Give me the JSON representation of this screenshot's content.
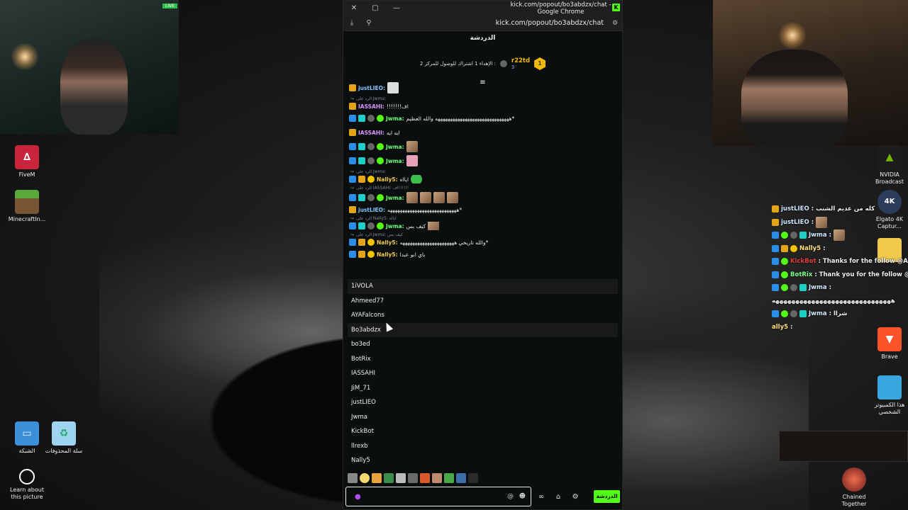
{
  "window": {
    "title": "kick.com/popout/bo3abdzx/chat - Google Chrome",
    "url": "kick.com/popout/bo3abdzx/chat",
    "brand_color": "#53fc18"
  },
  "chat": {
    "header": "الدردشة",
    "pinned": {
      "rank": "1",
      "username": "r22td",
      "count": "3",
      "text": "الإهداء 1 اشتراك للوصول للمركز 2 :"
    },
    "messages": [
      {
        "user": "justLIEO:",
        "text": ""
      },
      {
        "reply": "الرد على Jwma:"
      },
      {
        "user": "IASSAHI:",
        "text": "!!!!!!!اف"
      },
      {
        "user": "Jwma:",
        "text": "ههههههههههههههههههههههههههههههه والله العظيم*"
      },
      {
        "user": "IASSAHI:",
        "text": "ايه ايه"
      },
      {
        "user": "Jwma:",
        "text": ""
      },
      {
        "user": "Jwma:",
        "text": ""
      },
      {
        "reply": "الرد على Jwma:"
      },
      {
        "user": "Nally5:",
        "text": "ايااه"
      },
      {
        "reply": "الرد على IASSAHI: اف!!!!!!"
      },
      {
        "user": "Jwma:",
        "text": ""
      },
      {
        "user": "justLIEO:",
        "text": "ههههههههههههههههههههههههههههه*"
      },
      {
        "reply": "الرد على Nally5: ايااه"
      },
      {
        "user": "Jwma:",
        "text": "كيف بس"
      },
      {
        "reply": "الرد على Jwma: كيف بس"
      },
      {
        "user": "Nally5:",
        "text": "والله تاريخي ههههههههههههههههههههههه*"
      },
      {
        "user": "Nally5:",
        "text": "باي ابو عبدا"
      }
    ],
    "mentions": [
      "1iVOLA",
      "Ahmeed77",
      "AYAFalcons",
      "Bo3abdzx",
      "bo3ed",
      "BotRix",
      "IASSAHI",
      "JiM_71",
      "justLIEO",
      "Jwma",
      "KickBot",
      "llrexb",
      "Nally5"
    ],
    "input": {
      "value": "",
      "placeholder": ""
    },
    "send_label": "الدردشة"
  },
  "overlay": {
    "messages": [
      {
        "user": "justLIEO",
        "text": ": كله من عديم الشنب",
        "color": "blue"
      },
      {
        "user": "justLIEO",
        "text": ":",
        "color": "blue"
      },
      {
        "user": "Jwma",
        "text": ":",
        "color": "blue"
      },
      {
        "user": "Nally5",
        "text": ":",
        "color": "yel"
      },
      {
        "user": "KickBot",
        "text": ": Thanks for the follow @A",
        "color": "red"
      },
      {
        "user": "BotRix",
        "text": ": Thank you for the follow @",
        "color": "green"
      },
      {
        "user": "Jwma",
        "text": ":",
        "color": "blue"
      },
      {
        "user": "",
        "text": "ههههههههههههههههههههههههههههههه",
        "color": "blue"
      },
      {
        "user": "Jwma",
        "text": ": شراا",
        "color": "blue"
      },
      {
        "user": "ally5",
        "text": ":",
        "color": "yel"
      }
    ]
  },
  "desktop": {
    "icons_left": [
      {
        "label": "FiveM",
        "icon": "fivem-icon"
      },
      {
        "label": "MinecraftIn...",
        "icon": "minecraft-icon"
      },
      {
        "label": "الشبكة",
        "icon": "network-icon"
      },
      {
        "label": "سلة المحذوفات",
        "icon": "recycle-bin-icon"
      },
      {
        "label": "Learn about this picture",
        "icon": "learn-icon"
      }
    ],
    "icons_right": [
      {
        "label": "NVIDIA Broadcast",
        "icon": "nvidia-icon"
      },
      {
        "label": "Elgato 4K Captur...",
        "icon": "elgato-icon"
      },
      {
        "label": "",
        "icon": "folder-icon"
      },
      {
        "label": "Brave",
        "icon": "brave-icon"
      },
      {
        "label": "هذا الكمبيوتر الشخصي",
        "icon": "this-pc-icon"
      },
      {
        "label": "Chained Together",
        "icon": "chained-together-icon"
      }
    ],
    "cam_badge": "LIVE"
  }
}
